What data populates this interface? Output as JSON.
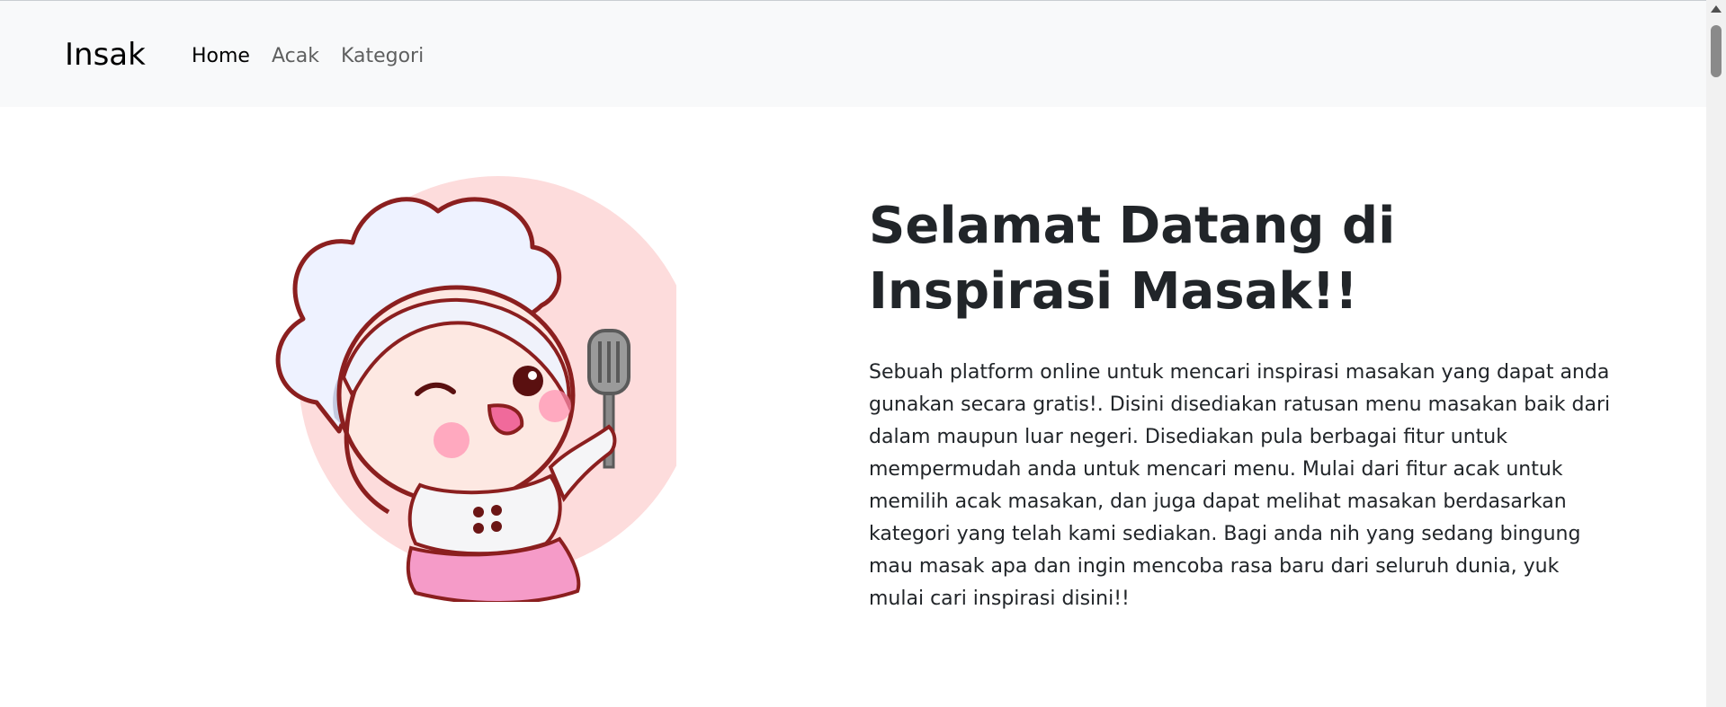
{
  "navbar": {
    "brand": "Insak",
    "links": [
      {
        "label": "Home",
        "active": true
      },
      {
        "label": "Acak",
        "active": false
      },
      {
        "label": "Kategori",
        "active": false
      }
    ]
  },
  "hero": {
    "image": "chef-girl-illustration",
    "title": "Selamat Datang di Inspirasi Masak!!",
    "description": "Sebuah platform online untuk mencari inspirasi masakan yang dapat anda gunakan secara gratis!. Disini disediakan ratusan menu masakan baik dari dalam maupun luar negeri. Disediakan pula berbagai fitur untuk mempermudah anda untuk mencari menu. Mulai dari fitur acak untuk memilih acak masakan, dan juga dapat melihat masakan berdasarkan kategori yang telah kami sediakan. Bagi anda nih yang sedang bingung mau masak apa dan ingin mencoba rasa baru dari seluruh dunia, yuk mulai cari inspirasi disini!!"
  },
  "colors": {
    "navbar_bg": "#f8f9fa",
    "text": "#212529",
    "illustration_circle": "#fddcdc",
    "apron": "#f59bc8",
    "outline": "#8b1f1f"
  }
}
